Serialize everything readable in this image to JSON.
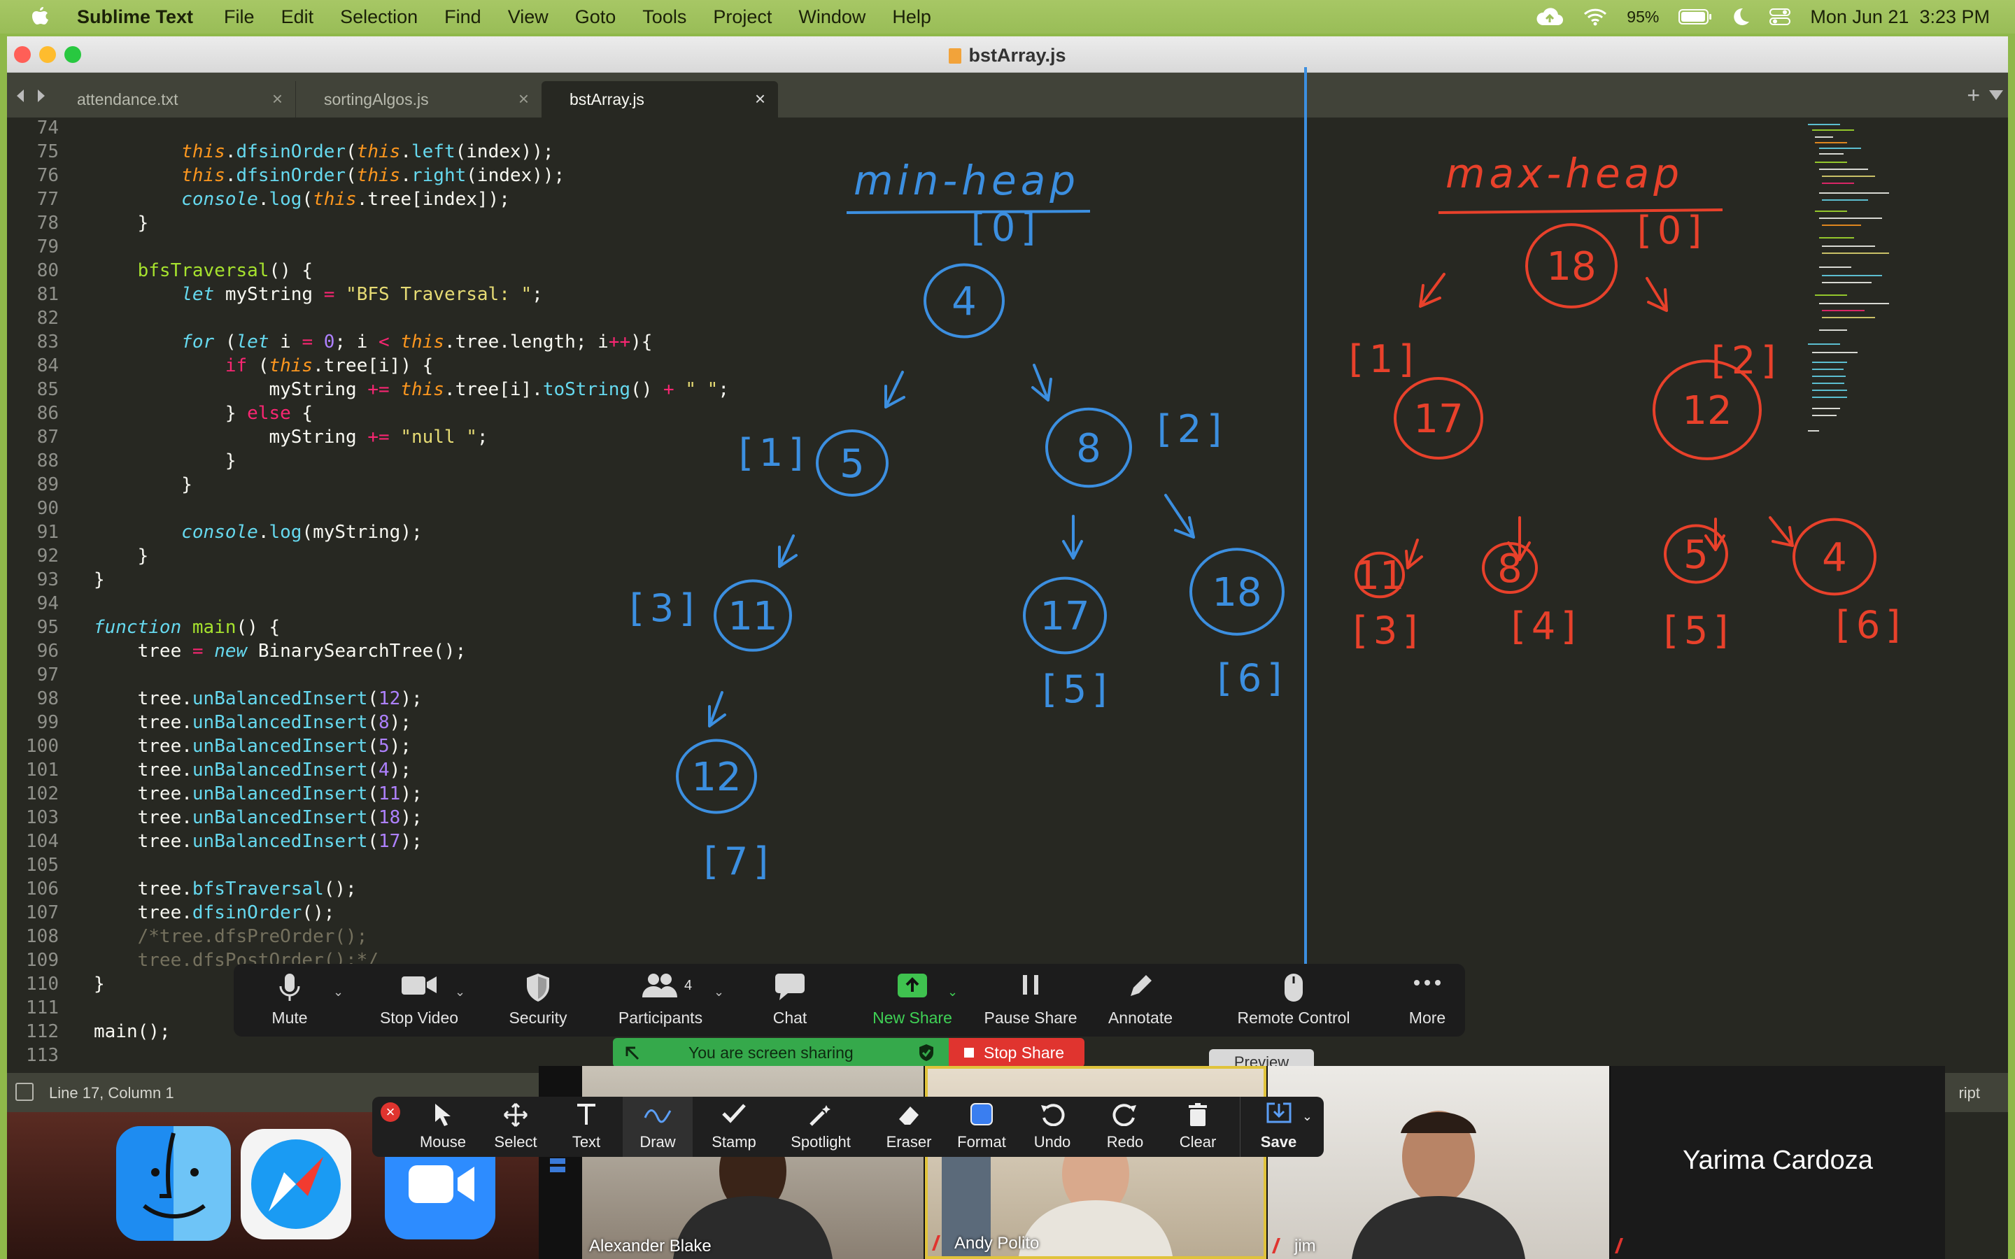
{
  "menubar": {
    "app": "Sublime Text",
    "items": [
      "File",
      "Edit",
      "Selection",
      "Find",
      "View",
      "Goto",
      "Tools",
      "Project",
      "Window",
      "Help"
    ],
    "battery": "95%",
    "datetime": "Mon Jun 21  3:23 PM"
  },
  "window": {
    "title": "bstArray.js",
    "tabs": [
      {
        "label": "attendance.txt"
      },
      {
        "label": "sortingAlgos.js"
      },
      {
        "label": "bstArray.js",
        "active": true
      }
    ]
  },
  "editor": {
    "line_numbers": [
      "74",
      "75",
      "76",
      "77",
      "78",
      "79",
      "80",
      "81",
      "82",
      "83",
      "84",
      "85",
      "86",
      "87",
      "88",
      "89",
      "90",
      "91",
      "92",
      "93",
      "94",
      "95",
      "96",
      "97",
      "98",
      "99",
      "100",
      "101",
      "102",
      "103",
      "104",
      "105",
      "106",
      "107",
      "108",
      "109",
      "110",
      "111",
      "112",
      "113"
    ],
    "lines": [
      "",
      "        this.dfsinOrder(this.left(index));",
      "        this.dfsinOrder(this.right(index));",
      "        console.log(this.tree[index]);",
      "    }",
      "",
      "    bfsTraversal() {",
      "        let myString = \"BFS Traversal: \";",
      "",
      "        for (let i = 0; i < this.tree.length; i++){",
      "            if (this.tree[i]) {",
      "                myString += this.tree[i].toString() + \" \";",
      "            } else {",
      "                myString += \"null \";",
      "            }",
      "        }",
      "",
      "        console.log(myString);",
      "    }",
      "}",
      "",
      "function main() {",
      "    tree = new BinarySearchTree();",
      "",
      "    tree.unBalancedInsert(12);",
      "    tree.unBalancedInsert(8);",
      "    tree.unBalancedInsert(5);",
      "    tree.unBalancedInsert(4);",
      "    tree.unBalancedInsert(11);",
      "    tree.unBalancedInsert(18);",
      "    tree.unBalancedInsert(17);",
      "",
      "    tree.bfsTraversal();",
      "    tree.dfsinOrder();",
      "    /*tree.dfsPreOrder();",
      "    tree.dfsPostOrder();*/",
      "}",
      "",
      "main();",
      ""
    ]
  },
  "annotations": {
    "min_heap_title": "min-heap",
    "max_heap_title": "max-heap",
    "min_heap_nodes": [
      {
        "value": "4",
        "index": "[0]"
      },
      {
        "value": "5",
        "index": "[1]"
      },
      {
        "value": "8",
        "index": "[2]"
      },
      {
        "value": "11",
        "index": "[3]"
      },
      {
        "value": "17",
        "index": "[5]"
      },
      {
        "value": "18",
        "index": "[6]"
      },
      {
        "value": "12",
        "index": "[7]"
      }
    ],
    "max_heap_nodes": [
      {
        "value": "18",
        "index": "[0]"
      },
      {
        "value": "17",
        "index": "[1]"
      },
      {
        "value": "12",
        "index": "[2]"
      },
      {
        "value": "11",
        "index": "[3]"
      },
      {
        "value": "8",
        "index": "[4]"
      },
      {
        "value": "5",
        "index": "[5]"
      },
      {
        "value": "4",
        "index": "[6]"
      }
    ],
    "colors": {
      "min_heap": "#3c8fe0",
      "max_heap": "#e8412b"
    }
  },
  "statusbar": {
    "position": "Line 17, Column 1",
    "syntax": "ript"
  },
  "zoom_controls": {
    "buttons": [
      "Mute",
      "Stop Video",
      "Security",
      "Participants",
      "Chat",
      "New Share",
      "Pause Share",
      "Annotate",
      "Remote Control",
      "More"
    ],
    "participants_count": "4",
    "sharing_status": "You are screen sharing",
    "stop_share": "Stop Share",
    "preview_label": "Preview"
  },
  "annotation_toolbar": {
    "tools": [
      "Mouse",
      "Select",
      "Text",
      "Draw",
      "Stamp",
      "Spotlight",
      "Eraser",
      "Format",
      "Undo",
      "Redo",
      "Clear",
      "Save"
    ]
  },
  "participants": [
    {
      "name": "Alexander Blake"
    },
    {
      "name": "Andy Polito"
    },
    {
      "name": "jim"
    },
    {
      "name": "Yarima Cardoza"
    }
  ]
}
